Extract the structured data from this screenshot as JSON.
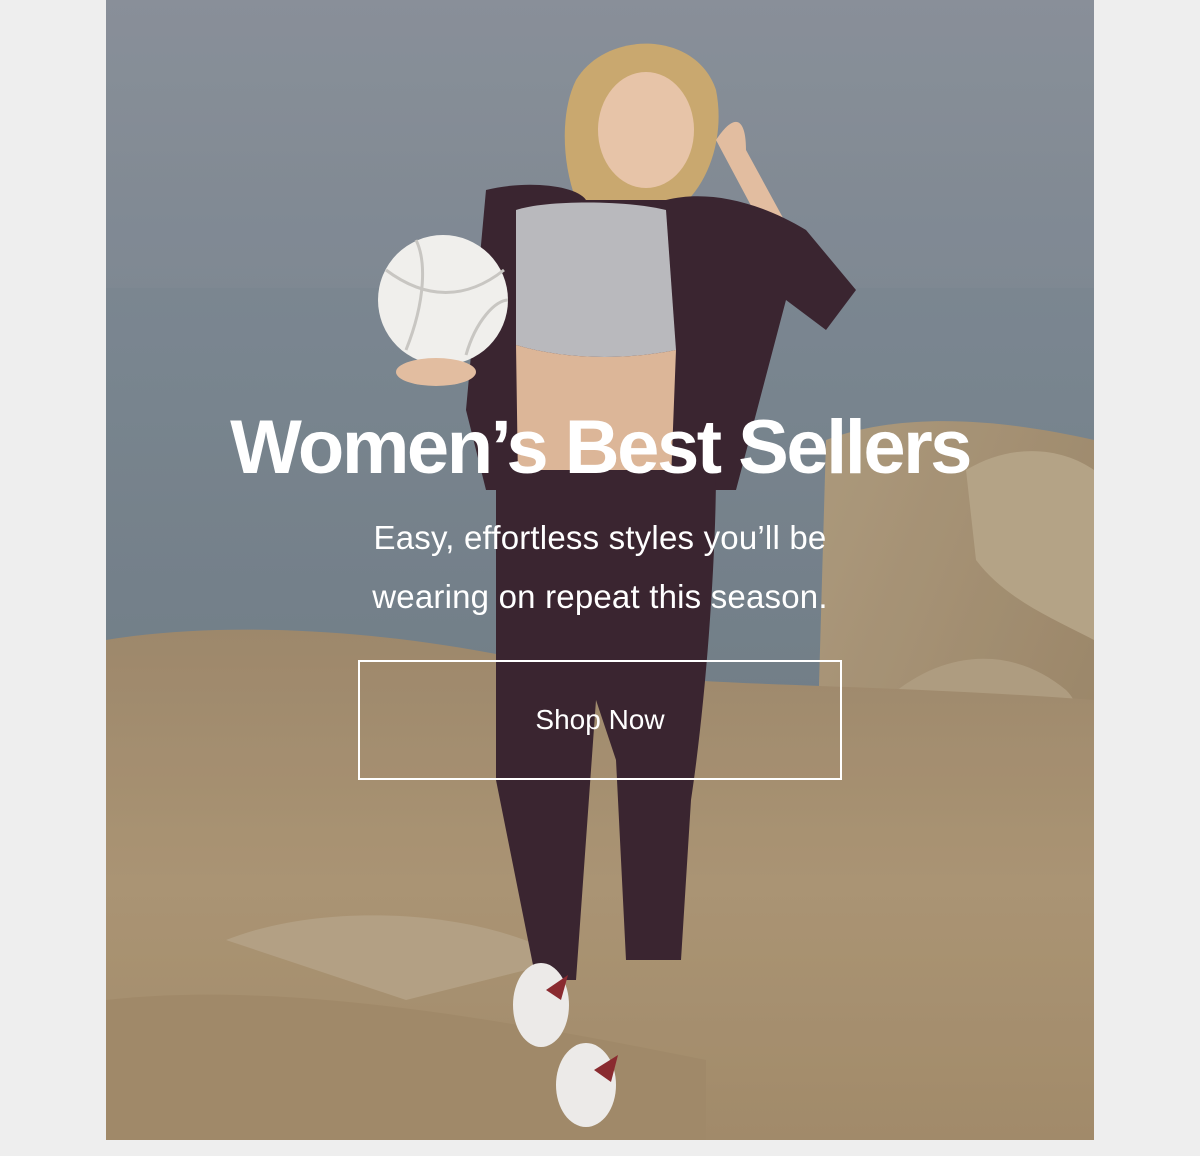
{
  "hero": {
    "image_alt": "Woman in a dark plum hoodie and joggers holding a volleyball on sandy rocks by the sea",
    "headline": "Women’s Best Sellers",
    "subcopy_line1": "Easy, effortless styles you’ll be",
    "subcopy_line2": "wearing on repeat this season.",
    "cta_label": "Shop Now"
  },
  "colors": {
    "page_background": "#eeeeee",
    "text": "#ffffff",
    "outfit": "#3a2530",
    "sand": "#c8ad84",
    "sky": "#9aa1a8"
  }
}
